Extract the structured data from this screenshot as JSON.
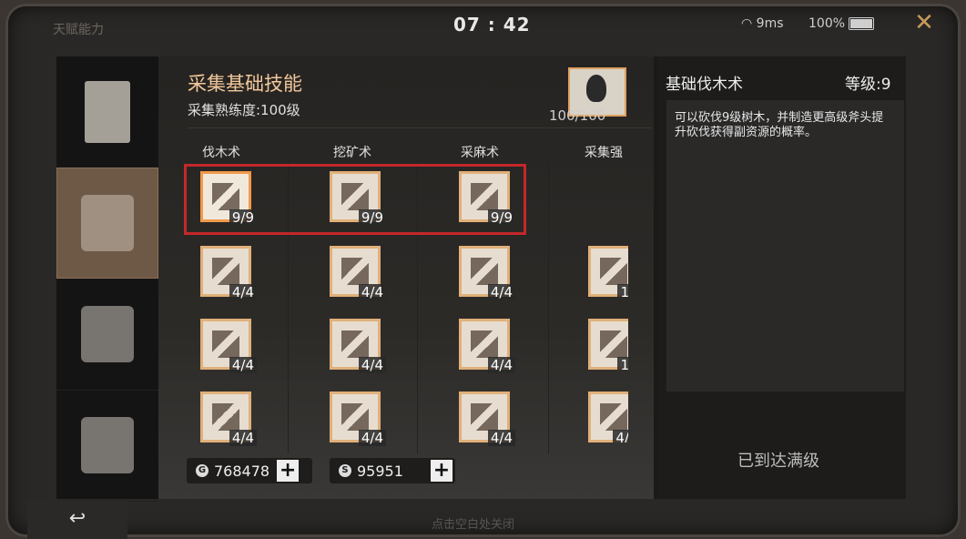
{
  "topbar": {
    "title": "天赋能力",
    "time": "07 : 42",
    "wifi": "9ms",
    "battery": "100%"
  },
  "sidebar": {
    "items": [
      {
        "icon": "certificate-icon",
        "active": false
      },
      {
        "icon": "leaf-emblem-icon",
        "active": true
      },
      {
        "icon": "gear-hammer-icon",
        "active": false
      },
      {
        "icon": "crossed-weapons-icon",
        "active": false
      }
    ]
  },
  "header": {
    "title": "采集基础技能",
    "proficiency": "采集熟练度:100级",
    "progress": "100/100"
  },
  "columns": [
    "伐木术",
    "挖矿术",
    "采麻术",
    "采集强"
  ],
  "skills": {
    "row1": [
      "9/9",
      "9/9",
      "9/9"
    ],
    "row2": [
      "4/4",
      "4/4",
      "4/4",
      "1"
    ],
    "row3": [
      "4/4",
      "4/4",
      "4/4",
      "1"
    ],
    "row4": [
      "4/4",
      "4/4",
      "4/4",
      "4/"
    ]
  },
  "currency": {
    "gold": "768478",
    "silver": "95951"
  },
  "detail": {
    "title": "基础伐木术",
    "level": "等级:9",
    "description": "可以砍伐9级树木，并制造更高级斧头提升砍伐获得副资源的概率。",
    "status": "已到达满级"
  },
  "footer": {
    "back_icon": "back-arrow-icon",
    "back": "↩",
    "hint": "点击空白处关闭"
  },
  "colors": {
    "accent_orange": "#f2c89a",
    "selection_red": "#c4282a",
    "active_tab": "#6e5846"
  }
}
